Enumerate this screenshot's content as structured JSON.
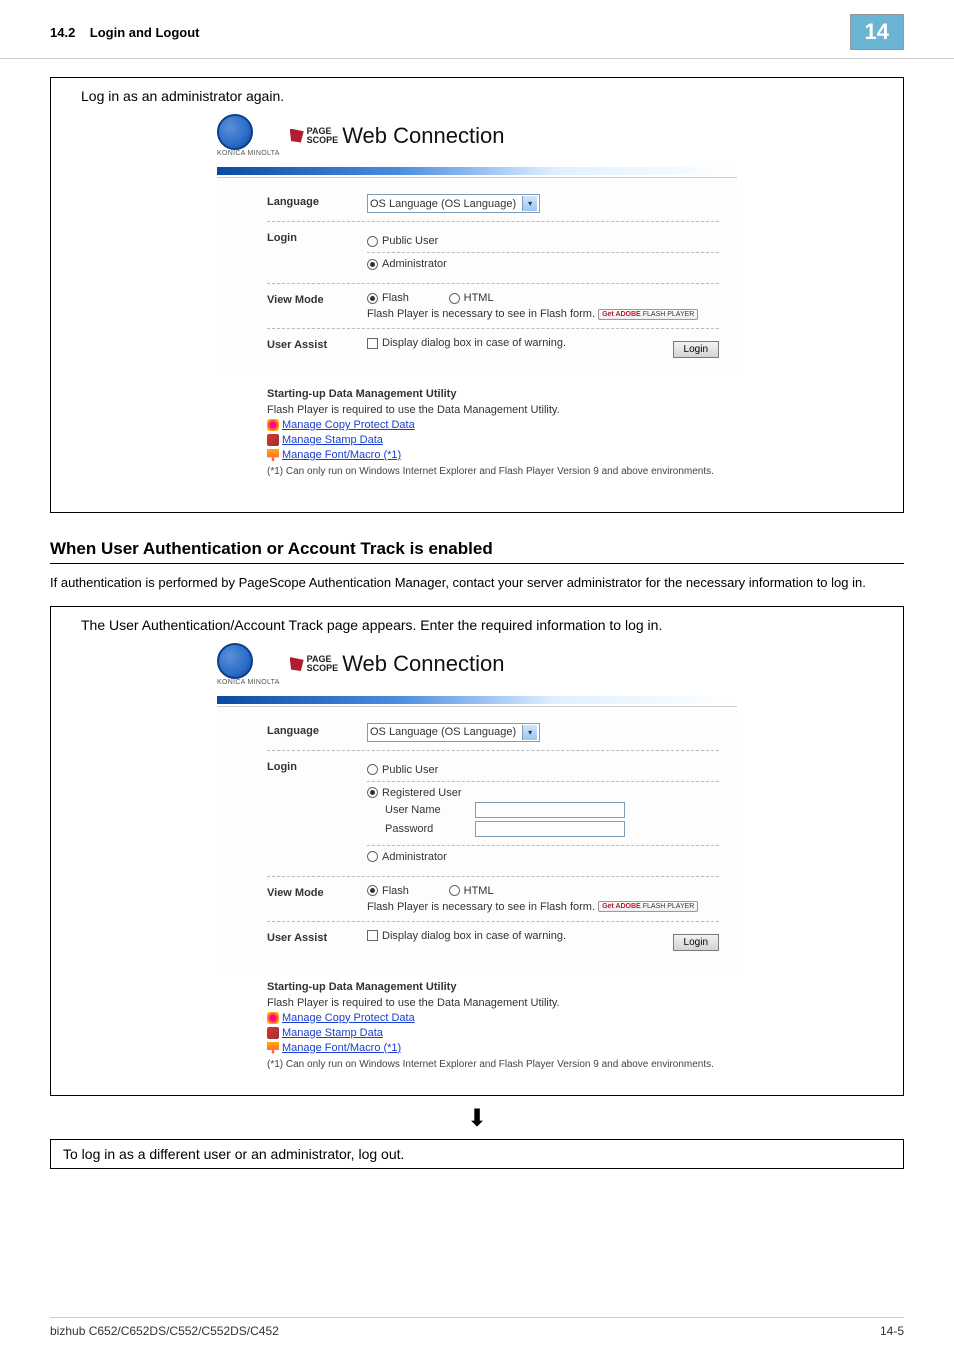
{
  "header": {
    "section": "14.2",
    "title": "Login and Logout",
    "chapter": "14"
  },
  "box1": {
    "caption": "Log in as an administrator again.",
    "brand_sub": "KONICA MINOLTA",
    "scope1": "PAGE",
    "scope2": "SCOPE",
    "wc_title": "Web Connection",
    "language_label": "Language",
    "language_value": "OS Language (OS Language)",
    "login_label": "Login",
    "public_user": "Public User",
    "administrator": "Administrator",
    "view_mode_label": "View Mode",
    "flash": "Flash",
    "html": "HTML",
    "flash_note": "Flash Player is necessary to see in Flash form.",
    "adobe1": "Get ADOBE",
    "adobe2": "FLASH PLAYER",
    "user_assist_label": "User Assist",
    "display_dialog": "Display dialog box in case of warning.",
    "login_btn": "Login",
    "util_title": "Starting-up Data Management Utility",
    "util_desc": "Flash Player is required to use the Data Management Utility.",
    "link1": "Manage Copy Protect Data",
    "link2": "Manage Stamp Data",
    "link3": "Manage Font/Macro (*1)",
    "footnote": "(*1) Can only run on Windows Internet Explorer and Flash Player Version 9 and above environments."
  },
  "subheading": "When User Authentication or Account Track is enabled",
  "body_text": "If authentication is performed by PageScope Authentication Manager, contact your server administrator for the necessary information to log in.",
  "box2": {
    "caption": "The User Authentication/Account Track page appears. Enter the required information to log in.",
    "registered_user": "Registered User",
    "user_name": "User Name",
    "password": "Password"
  },
  "final_box": "To log in as a different user or an administrator, log out.",
  "footer": {
    "model": "bizhub C652/C652DS/C552/C552DS/C452",
    "page": "14-5"
  }
}
